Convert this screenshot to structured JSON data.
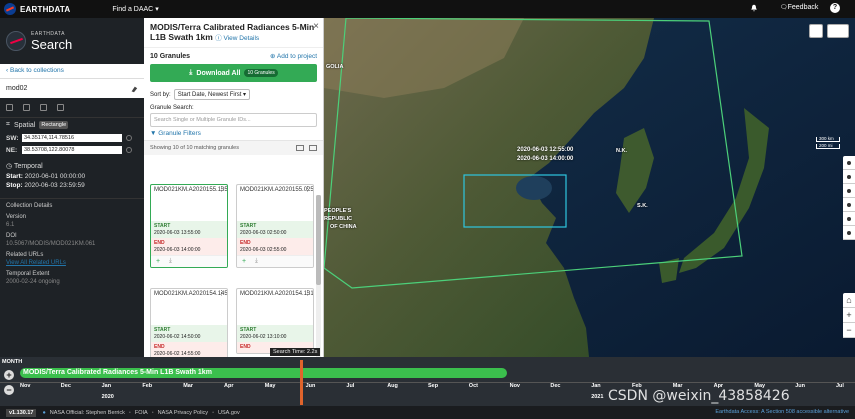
{
  "topnav": {
    "brand": "EARTHDATA",
    "daac": "Find a DAAC",
    "feedback": "Feedback",
    "help": "?"
  },
  "left": {
    "logo_small": "EARTHDATA",
    "logo_big": "Search",
    "back": "Back to collections",
    "collection_query": "mod02",
    "spatial_label": "Spatial",
    "spatial_type": "Rectangle",
    "sw_label": "SW:",
    "sw_value": "34.35174,114.78516",
    "ne_label": "NE:",
    "ne_value": "38.53708,122.80078",
    "temporal_label": "Temporal",
    "start_label": "Start:",
    "start_value": "2020-06-01 00:00:00",
    "stop_label": "Stop:",
    "stop_value": "2020-06-03 23:59:59",
    "details": {
      "heading": "Collection Details",
      "version_label": "Version",
      "version": "6.1",
      "doi_label": "DOI",
      "doi": "10.5067/MODIS/MOD021KM.061",
      "urls_label": "Related URLs",
      "urls_link": "View All Related URLs",
      "extent_label": "Temporal Extent",
      "extent": "2000-02-24 ongoing"
    }
  },
  "granules": {
    "title": "MODIS/Terra Calibrated Radiances 5-Min L1B Swath 1km",
    "view_details": "View Details",
    "count": "10 Granules",
    "add_project": "Add to project",
    "download_all": "Download All",
    "download_badge": "10 Granules",
    "sort_label": "Sort by:",
    "sort_value": "Start Date, Newest First",
    "search_label": "Granule Search:",
    "search_placeholder": "Search Single or Multiple Granule IDs...",
    "filters": "Granule Filters",
    "showing": "Showing 10 of 10 matching granules",
    "start_label": "START",
    "end_label": "END",
    "cards": [
      {
        "name": "MOD021KM.A2020155.1355.061.2020155011315.hdf",
        "start": "2020-06-03 13:55:00",
        "end": "2020-06-03 14:00:00"
      },
      {
        "name": "MOD021KM.A2020155.0250.061.2020155131815.hdf",
        "start": "2020-06-03 02:50:00",
        "end": "2020-06-03 02:55:00"
      },
      {
        "name": "MOD021KM.A2020154.1450.061.2020155012030.hdf",
        "start": "2020-06-02 14:50:00",
        "end": "2020-06-02 14:55:00"
      },
      {
        "name": "MOD021KM.A2020154.1310.061.2020155011901.hdf",
        "start": "2020-06-02 13:10:00",
        "end": ""
      }
    ],
    "search_time": "Search Time: 2.2s"
  },
  "map": {
    "labels": {
      "mongolia": "GOLIA",
      "nk": "N.K.",
      "sk": "S.K.",
      "prc1": "PEOPLE'S",
      "prc2": "REPUBLIC",
      "prc3": "OF CHINA",
      "ts1": "2020-06-03 12:55:00",
      "ts2": "2020-06-03 14:00:00"
    },
    "scale_km": "300 km",
    "scale_mi": "200 mi",
    "zoom_in": "+",
    "zoom_out": "−"
  },
  "timeline": {
    "heading": "MONTH",
    "bar_label": "MODIS/Terra Calibrated Radiances 5-Min L1B Swath 1km",
    "plus": "+",
    "minus": "−",
    "months": [
      "Nov",
      "Dec",
      "Jan",
      "Feb",
      "Mar",
      "Apr",
      "May",
      "Jun",
      "Jul",
      "Aug",
      "Sep",
      "Oct",
      "Nov",
      "Dec",
      "Jan",
      "Feb",
      "Mar",
      "Apr",
      "May",
      "Jun",
      "Jul"
    ],
    "years": [
      "2020",
      "2021"
    ]
  },
  "footer": {
    "version": "v1.130.17",
    "official": "NASA Official: Stephen Berrick",
    "foia": "FOIA",
    "privacy": "NASA Privacy Policy",
    "usagov": "USA.gov",
    "right": "Earthdata Access: A Section 508 accessible alternative"
  },
  "watermark": "CSDN @weixin_43858426",
  "colors": {
    "accent_green": "#33aa55",
    "link_blue": "#2275aa",
    "footprint_green": "#4cd07a",
    "bbox_cyan": "#2ec6e0",
    "timeline_focus": "#e0642c"
  }
}
